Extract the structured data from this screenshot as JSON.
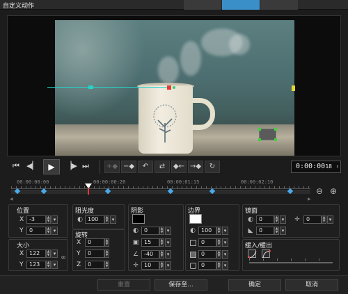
{
  "window": {
    "title": "自定义动作"
  },
  "transport": {
    "timecode": "0:00:00",
    "frames": "18",
    "icons": [
      "skip-to-start-icon",
      "prev-frame-icon",
      "play-icon",
      "next-frame-icon",
      "skip-to-end-icon"
    ],
    "keyframe_icons": [
      "add-keyframe-icon",
      "remove-keyframe-icon",
      "flip-keyframe-icon",
      "keyframe-swap-icon",
      "prev-keyframe-icon",
      "next-keyframe-icon",
      "reset-keyframe-icon"
    ]
  },
  "timeline": {
    "ruler_labels": [
      "00:00:00:00",
      "00:00:00:20",
      "00:00:01:15",
      "00:00:02:10"
    ]
  },
  "position": {
    "title": "位置",
    "x_label": "X",
    "x": "-3",
    "y_label": "Y",
    "y": "0"
  },
  "size": {
    "title": "大小",
    "x_label": "X",
    "x": "122",
    "y_label": "Y",
    "y": "123"
  },
  "opacity": {
    "title": "阻光度",
    "value": "100"
  },
  "rotation": {
    "title": "旋转",
    "x_label": "X",
    "x": "0",
    "y_label": "Y",
    "y": "0",
    "z_label": "Z",
    "z": "0"
  },
  "shadow": {
    "title": "阴影",
    "color": "#000000",
    "opacity": "0",
    "blur": "15",
    "angle": "-40",
    "distance": "10"
  },
  "border": {
    "title": "边界",
    "color": "#ffffff",
    "opacity": "100",
    "width": "0",
    "v2": "0",
    "v3": "0"
  },
  "mirror": {
    "title": "镜面",
    "opacity": "0",
    "distance": "0",
    "offset": "0"
  },
  "ease": {
    "title": "缓入/缓出"
  },
  "footer": {
    "reset": "重置",
    "save_to": "保存至...",
    "ok": "确定",
    "cancel": "取消"
  },
  "colors": {
    "accent": "#3b8fc8",
    "keyframe": "#4aa9e8",
    "path": "#27d3c8"
  }
}
